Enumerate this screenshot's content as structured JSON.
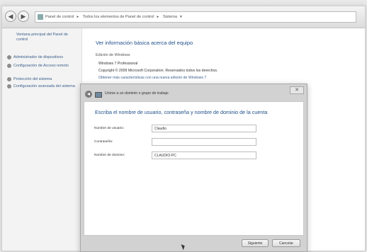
{
  "address_bar": {
    "icon": "control-panel-icon",
    "crumbs": [
      "Panel de control",
      "Todos los elementos de Panel de control",
      "Sistema"
    ]
  },
  "sidebar": {
    "home_link": "Ventana principal del Panel de control",
    "items": [
      {
        "label": "Administrador de dispositivos",
        "icon": "shield-icon"
      },
      {
        "label": "Configuración de Acceso remoto",
        "icon": "shield-icon"
      },
      {
        "label": "Protección del sistema",
        "icon": "shield-icon"
      },
      {
        "label": "Configuración avanzada del sistema",
        "icon": "shield-icon"
      }
    ]
  },
  "main": {
    "title": "Ver información básica acerca del equipo",
    "edition_heading": "Edición de Windows",
    "edition_lines": [
      "Windows 7 Professional",
      "Copyright © 2009 Microsoft Corporation. Reservados todos los derechos."
    ],
    "upgrade_link": "Obtener más características con una nueva edición de Windows 7"
  },
  "dialog": {
    "title": "Unirse a un dominio o grupo de trabajo",
    "heading": "Escriba el nombre de usuario, contraseña y nombre de dominio de la cuenta",
    "fields": {
      "username": {
        "label": "Nombre de usuario:",
        "value": "Claudio"
      },
      "password": {
        "label": "Contraseña:",
        "value": ""
      },
      "domain": {
        "label": "Nombre de dominio:",
        "value": "CLAUDIO-PC"
      }
    },
    "buttons": {
      "next": "Siguiente",
      "cancel": "Cancelar"
    }
  }
}
